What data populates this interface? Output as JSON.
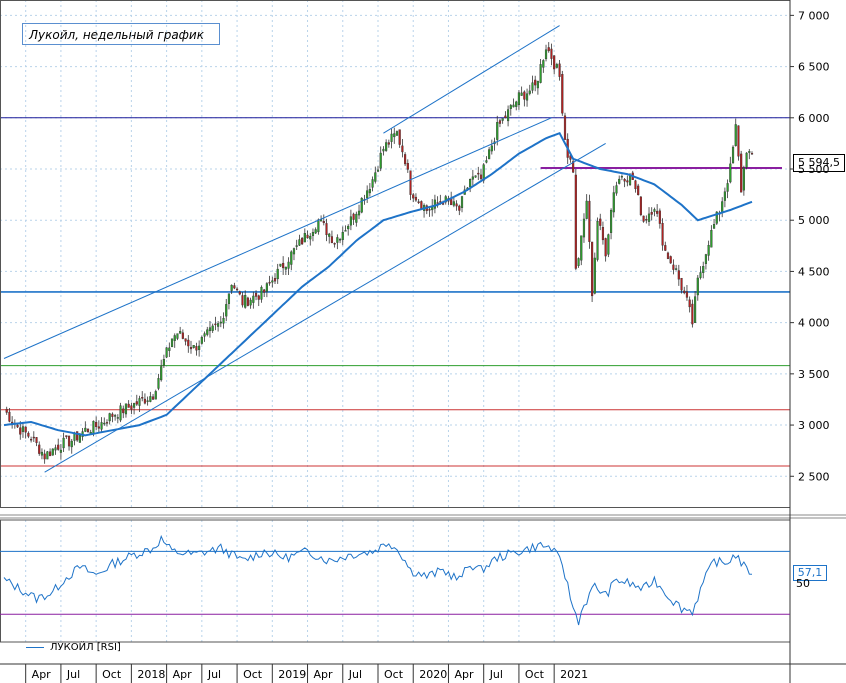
{
  "title": "Лукойл, недельный график",
  "price_badge": "5 594,5",
  "rsi_badge": "57,1",
  "rsi_legend": "ЛУКОЙЛ [RSI]",
  "colors": {
    "candle_up": "#2e9e2e",
    "candle_down": "#b22222",
    "ma": "#1e73c8",
    "channel": "#1e73c8",
    "support_blue": "#1e73c8",
    "level_navy": "#1b1b9a",
    "level_green": "#2e9e2e",
    "level_red": "#cc3333",
    "level_purple": "#8a1fa0",
    "grid": "#b9d3ea"
  },
  "chart_data": [
    {
      "type": "candlestick",
      "title": "Лукойл, недельный график",
      "y_ticks": [
        "7 000",
        "6 500",
        "6 000",
        "5 500",
        "5 000",
        "4 500",
        "4 000",
        "3 500",
        "3 000",
        "2 500"
      ],
      "ylim": [
        2200,
        7150
      ],
      "x_ticks": [
        "Apr",
        "Jul",
        "Oct",
        "2018",
        "Apr",
        "Jul",
        "Oct",
        "2019",
        "Apr",
        "Jul",
        "Oct",
        "2020",
        "Apr",
        "Jul",
        "Oct",
        "2021"
      ],
      "horizontal_levels": [
        {
          "value": 6000,
          "color_key": "level_navy"
        },
        {
          "value": 4300,
          "color_key": "support_blue"
        },
        {
          "value": 3580,
          "color_key": "level_green"
        },
        {
          "value": 3150,
          "color_key": "level_red"
        },
        {
          "value": 2600,
          "color_key": "level_red"
        }
      ],
      "resistance_segment": {
        "value": 5510,
        "from_week": 198,
        "to_week": 276
      },
      "channel_lines": [
        {
          "from": [
            0,
            3650
          ],
          "to": [
            202,
            6000
          ]
        },
        {
          "from": [
            15,
            2540
          ],
          "to": [
            222,
            5750
          ]
        },
        {
          "from": [
            140,
            5850
          ],
          "to": [
            205,
            6900
          ]
        }
      ],
      "anchor_closes": [
        [
          0,
          3150
        ],
        [
          5,
          2980
        ],
        [
          10,
          2880
        ],
        [
          15,
          2700
        ],
        [
          20,
          2800
        ],
        [
          25,
          2850
        ],
        [
          30,
          2950
        ],
        [
          35,
          3000
        ],
        [
          40,
          3100
        ],
        [
          48,
          3200
        ],
        [
          55,
          3300
        ],
        [
          58,
          3550
        ],
        [
          62,
          3850
        ],
        [
          64,
          3900
        ],
        [
          70,
          3750
        ],
        [
          80,
          4000
        ],
        [
          84,
          4400
        ],
        [
          88,
          4200
        ],
        [
          96,
          4300
        ],
        [
          104,
          4600
        ],
        [
          110,
          4800
        ],
        [
          116,
          5000
        ],
        [
          122,
          4800
        ],
        [
          128,
          5000
        ],
        [
          136,
          5400
        ],
        [
          140,
          5700
        ],
        [
          145,
          5850
        ],
        [
          148,
          5600
        ],
        [
          150,
          5300
        ],
        [
          156,
          5100
        ],
        [
          162,
          5200
        ],
        [
          168,
          5100
        ],
        [
          172,
          5400
        ],
        [
          176,
          5400
        ],
        [
          182,
          5900
        ],
        [
          190,
          6200
        ],
        [
          196,
          6300
        ],
        [
          200,
          6700
        ],
        [
          202,
          6600
        ],
        [
          205,
          6400
        ],
        [
          207,
          5800
        ],
        [
          208,
          5650
        ],
        [
          210,
          5500
        ],
        [
          211,
          4500
        ],
        [
          213,
          4800
        ],
        [
          215,
          5200
        ],
        [
          217,
          4300
        ],
        [
          219,
          5000
        ],
        [
          222,
          4700
        ],
        [
          225,
          5300
        ],
        [
          228,
          5450
        ],
        [
          232,
          5400
        ],
        [
          236,
          5000
        ],
        [
          240,
          5150
        ],
        [
          244,
          4700
        ],
        [
          248,
          4500
        ],
        [
          252,
          4200
        ],
        [
          254,
          4000
        ],
        [
          256,
          4400
        ],
        [
          260,
          4800
        ],
        [
          264,
          5100
        ],
        [
          268,
          5500
        ],
        [
          270,
          5900
        ],
        [
          272,
          5300
        ],
        [
          274,
          5700
        ],
        [
          276,
          5595
        ]
      ],
      "ma_points": [
        [
          0,
          3000
        ],
        [
          10,
          3030
        ],
        [
          20,
          2950
        ],
        [
          30,
          2900
        ],
        [
          40,
          2950
        ],
        [
          50,
          3000
        ],
        [
          60,
          3100
        ],
        [
          70,
          3350
        ],
        [
          80,
          3600
        ],
        [
          90,
          3850
        ],
        [
          100,
          4100
        ],
        [
          110,
          4350
        ],
        [
          120,
          4550
        ],
        [
          130,
          4800
        ],
        [
          140,
          5000
        ],
        [
          150,
          5080
        ],
        [
          160,
          5150
        ],
        [
          170,
          5280
        ],
        [
          180,
          5450
        ],
        [
          190,
          5650
        ],
        [
          200,
          5800
        ],
        [
          205,
          5850
        ],
        [
          210,
          5600
        ],
        [
          220,
          5500
        ],
        [
          230,
          5450
        ],
        [
          240,
          5350
        ],
        [
          250,
          5150
        ],
        [
          256,
          5000
        ],
        [
          262,
          5050
        ],
        [
          268,
          5100
        ],
        [
          276,
          5180
        ]
      ],
      "rsi": {
        "badge": "57,1",
        "legend": "ЛУКОЙЛ [RSI]",
        "ylim": [
          20,
          90
        ],
        "levels": [
          70,
          30
        ],
        "tick_label": "50",
        "anchor_values": [
          [
            0,
            52
          ],
          [
            6,
            46
          ],
          [
            12,
            40
          ],
          [
            18,
            44
          ],
          [
            22,
            52
          ],
          [
            28,
            60
          ],
          [
            34,
            55
          ],
          [
            40,
            62
          ],
          [
            48,
            68
          ],
          [
            55,
            72
          ],
          [
            58,
            78
          ],
          [
            62,
            70
          ],
          [
            70,
            68
          ],
          [
            80,
            72
          ],
          [
            88,
            64
          ],
          [
            96,
            70
          ],
          [
            104,
            66
          ],
          [
            112,
            70
          ],
          [
            120,
            64
          ],
          [
            128,
            68
          ],
          [
            136,
            70
          ],
          [
            142,
            76
          ],
          [
            146,
            70
          ],
          [
            150,
            58
          ],
          [
            156,
            54
          ],
          [
            162,
            58
          ],
          [
            168,
            52
          ],
          [
            172,
            62
          ],
          [
            176,
            58
          ],
          [
            182,
            66
          ],
          [
            190,
            70
          ],
          [
            198,
            74
          ],
          [
            202,
            72
          ],
          [
            206,
            62
          ],
          [
            210,
            34
          ],
          [
            212,
            26
          ],
          [
            214,
            36
          ],
          [
            218,
            48
          ],
          [
            222,
            42
          ],
          [
            226,
            52
          ],
          [
            230,
            50
          ],
          [
            236,
            46
          ],
          [
            240,
            52
          ],
          [
            246,
            40
          ],
          [
            250,
            34
          ],
          [
            254,
            32
          ],
          [
            258,
            50
          ],
          [
            262,
            64
          ],
          [
            266,
            62
          ],
          [
            270,
            68
          ],
          [
            274,
            58
          ],
          [
            276,
            57.1
          ]
        ]
      }
    }
  ]
}
